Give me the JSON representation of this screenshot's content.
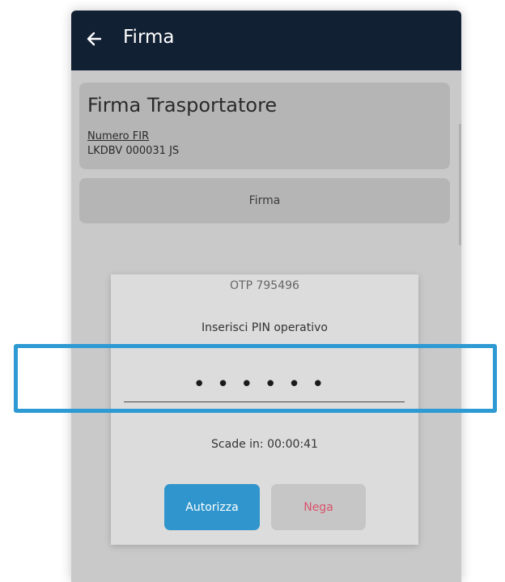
{
  "appbar": {
    "title": "Firma",
    "back_icon": "arrow-left-icon"
  },
  "card": {
    "title": "Firma Trasportatore",
    "label": "Numero FIR",
    "value": "LKDBV 000031 JS"
  },
  "firma_button": {
    "label": "Firma"
  },
  "dialog": {
    "otp": "OTP 795496",
    "prompt": "Inserisci PIN operativo",
    "pin_value": "••••••",
    "expires": "Scade in: 00:00:41",
    "authorize_label": "Autorizza",
    "deny_label": "Nega"
  },
  "colors": {
    "appbar_bg": "#122033",
    "accent": "#2f95cc",
    "deny_text": "#d9536a",
    "highlight": "#2d9ad3"
  }
}
